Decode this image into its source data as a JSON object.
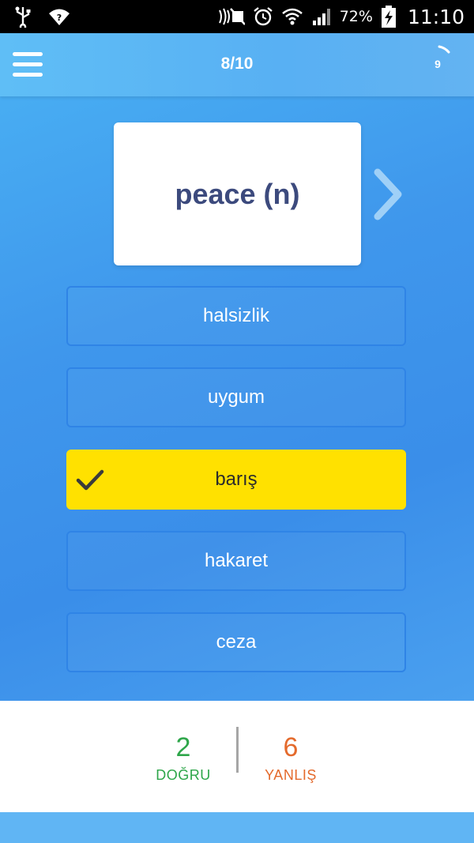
{
  "status_bar": {
    "battery": "72%",
    "time": "11:10",
    "icons": [
      "usb-icon",
      "wifi-question-icon",
      "nfc-icon",
      "mute-icon",
      "alarm-icon",
      "wifi-icon",
      "signal-icon",
      "battery-charging-icon"
    ]
  },
  "header": {
    "progress": "8/10",
    "timer_seconds": "9"
  },
  "question": {
    "word": "peace (n)"
  },
  "options": [
    {
      "label": "halsizlik",
      "selected": false
    },
    {
      "label": "uygum",
      "selected": false
    },
    {
      "label": "barış",
      "selected": true
    },
    {
      "label": "hakaret",
      "selected": false
    },
    {
      "label": "ceza",
      "selected": false
    }
  ],
  "score": {
    "correct_count": "2",
    "correct_label": "DOĞRU",
    "wrong_count": "6",
    "wrong_label": "YANLIŞ"
  },
  "colors": {
    "selected_option": "#ffe100",
    "correct": "#2ea64a",
    "wrong": "#e46a2c",
    "word": "#3c4a7d"
  }
}
